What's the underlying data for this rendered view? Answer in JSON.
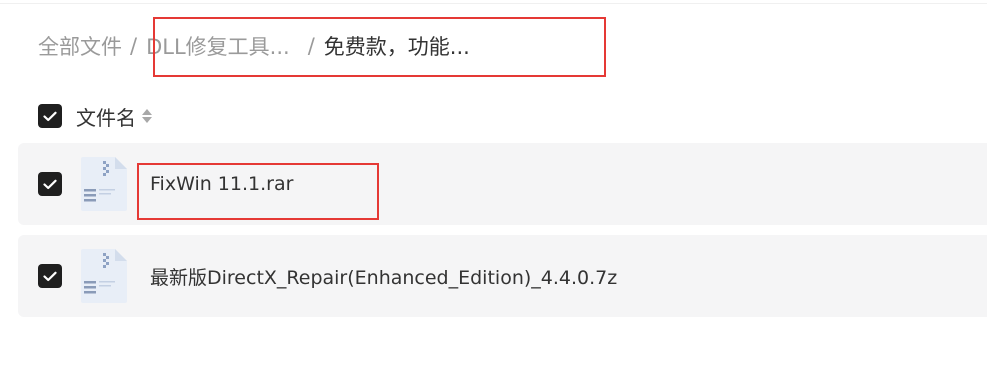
{
  "breadcrumb": {
    "root": "全部文件",
    "separator": "/",
    "folder": "DLL修复工具...",
    "current": "免费款，功能..."
  },
  "header": {
    "select_all_checked": true,
    "name_column_label": "文件名",
    "sort_icon": "sort-updown-icon"
  },
  "files": [
    {
      "name": "FixWin 11.1.rar",
      "checked": true,
      "icon": "archive-file-icon"
    },
    {
      "name": "最新版DirectX_Repair(Enhanced_Edition)_4.4.0.7z",
      "checked": true,
      "icon": "archive-file-icon"
    }
  ],
  "colors": {
    "highlight": "#e53935",
    "row_background": "#f5f5f6",
    "checkbox": "#1f1f1f",
    "muted_text": "#9a9a9a"
  }
}
